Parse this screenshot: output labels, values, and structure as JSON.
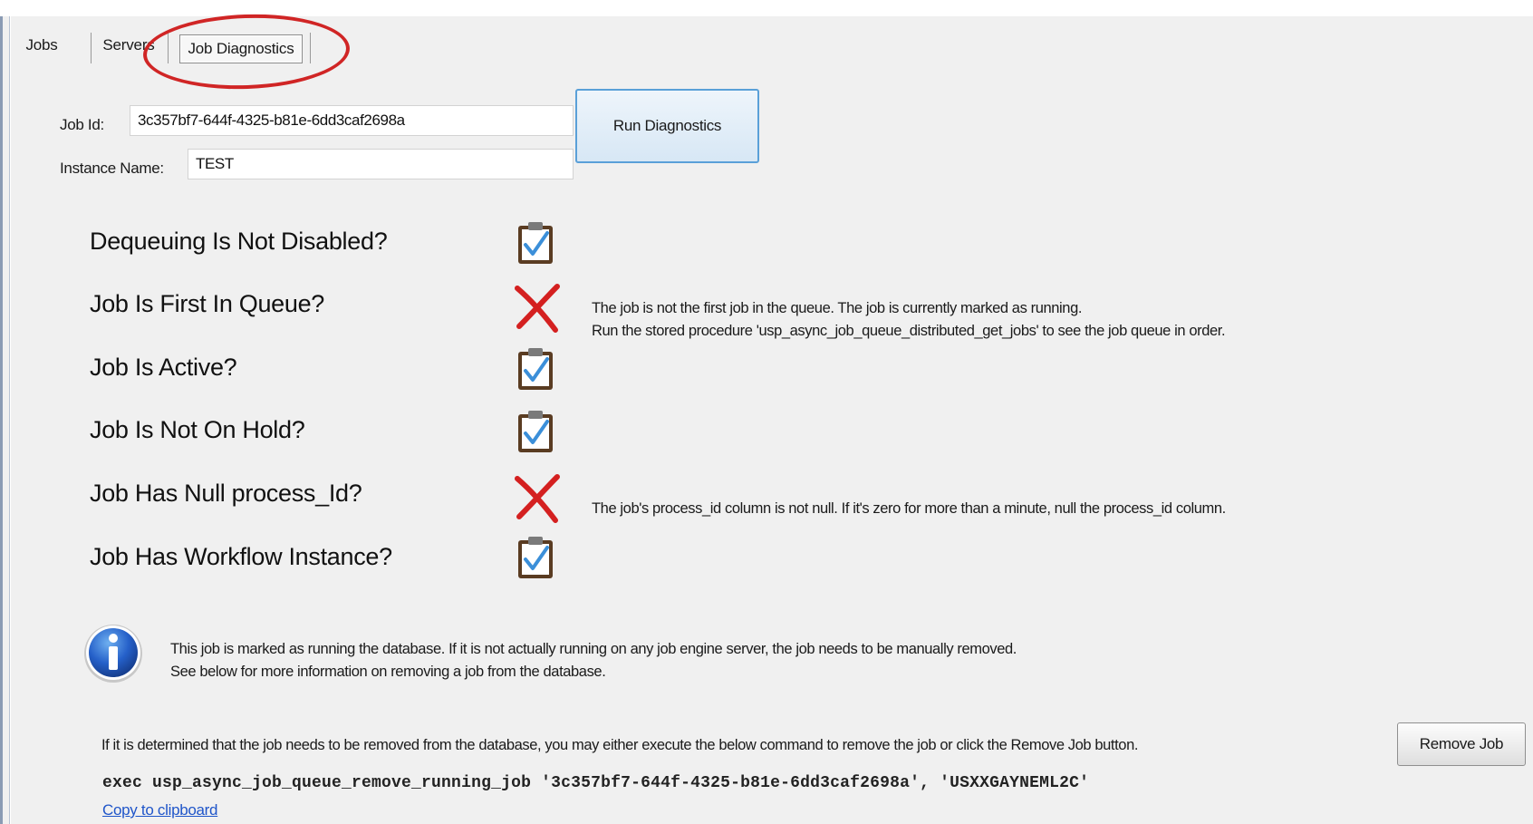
{
  "tabs": [
    {
      "label": "Jobs"
    },
    {
      "label": "Servers"
    },
    {
      "label": "Job Diagnostics"
    }
  ],
  "form": {
    "job_id_label": "Job Id:",
    "job_id_value": "3c357bf7-644f-4325-b81e-6dd3caf2698a",
    "instance_label": "Instance Name:",
    "instance_value": "TEST",
    "run_button": "Run Diagnostics"
  },
  "checks": [
    {
      "label": "Dequeuing Is Not Disabled?",
      "status": "pass",
      "message": ""
    },
    {
      "label": "Job Is First In Queue?",
      "status": "fail",
      "message": "The job is not the first job in the queue. The job is currently marked as running.\nRun the stored procedure 'usp_async_job_queue_distributed_get_jobs' to see the job queue in order."
    },
    {
      "label": "Job Is Active?",
      "status": "pass",
      "message": ""
    },
    {
      "label": "Job Is Not On Hold?",
      "status": "pass",
      "message": ""
    },
    {
      "label": "Job Has Null process_Id?",
      "status": "fail",
      "message": "The job's process_id column is not null. If it's zero for more than a minute, null the process_id column."
    },
    {
      "label": "Job Has Workflow Instance?",
      "status": "pass",
      "message": ""
    }
  ],
  "info": {
    "text": "This job is marked as running the database. If it is not actually running on any job engine server, the job needs to be manually removed.\nSee below for more information on removing a job from the database."
  },
  "removal": {
    "note": "If it is determined that the job needs to be removed from the database, you may either execute the below command to remove the job or click the Remove Job button.",
    "button": "Remove Job",
    "command": "exec usp_async_job_queue_remove_running_job '3c357bf7-644f-4325-b81e-6dd3caf2698a', 'USXXGAYNEML2C'",
    "copy_link": "Copy to clipboard"
  },
  "colors": {
    "pass": "#3b8fd9",
    "fail": "#d42020",
    "highlight": "#d02525",
    "link": "#1f55c9"
  },
  "icons": {
    "pass": "clipboard-check-icon",
    "fail": "red-x-icon",
    "info": "info-icon"
  }
}
